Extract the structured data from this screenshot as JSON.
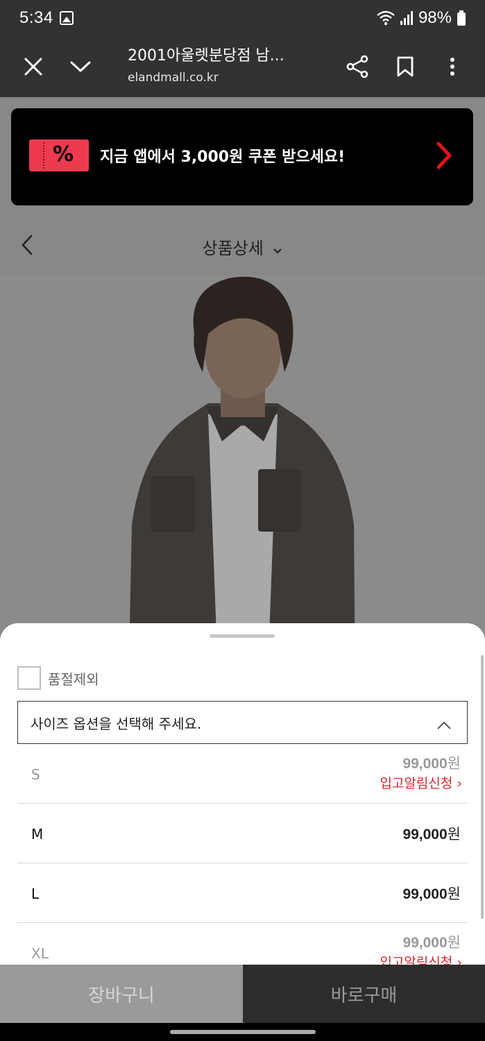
{
  "status_bar": {
    "time": "5:34",
    "battery": "98%"
  },
  "browser": {
    "title": "2001아울렛분당점 남...",
    "url": "elandmall.co.kr",
    "icons": [
      "close-icon",
      "chevron-down-icon",
      "share-icon",
      "bookmark-icon",
      "more-vertical-icon"
    ]
  },
  "promo": {
    "badge_symbol": "%",
    "text": "지금 앱에서 3,000원 쿠폰 받으세요!",
    "accent": "#ee3a4f"
  },
  "detail_header": {
    "title": "상품상세"
  },
  "sheet": {
    "exclude_soldout_label": "품절제외",
    "select_placeholder": "사이즈 옵션을 선택해 주세요.",
    "options": [
      {
        "size": "S",
        "price": "99,000",
        "unit": "원",
        "notify": "입고알림신청 ›",
        "soldout": true
      },
      {
        "size": "M",
        "price": "99,000",
        "unit": "원",
        "notify": "",
        "soldout": false
      },
      {
        "size": "L",
        "price": "99,000",
        "unit": "원",
        "notify": "",
        "soldout": false
      },
      {
        "size": "XL",
        "price": "99,000",
        "unit": "원",
        "notify": "입고알림신청 ›",
        "soldout": true
      }
    ]
  },
  "bottom_bar": {
    "cart_label": "장바구니",
    "buy_label": "바로구매"
  },
  "colors": {
    "notify_red": "#d8262e",
    "dark_bar": "#323232"
  }
}
